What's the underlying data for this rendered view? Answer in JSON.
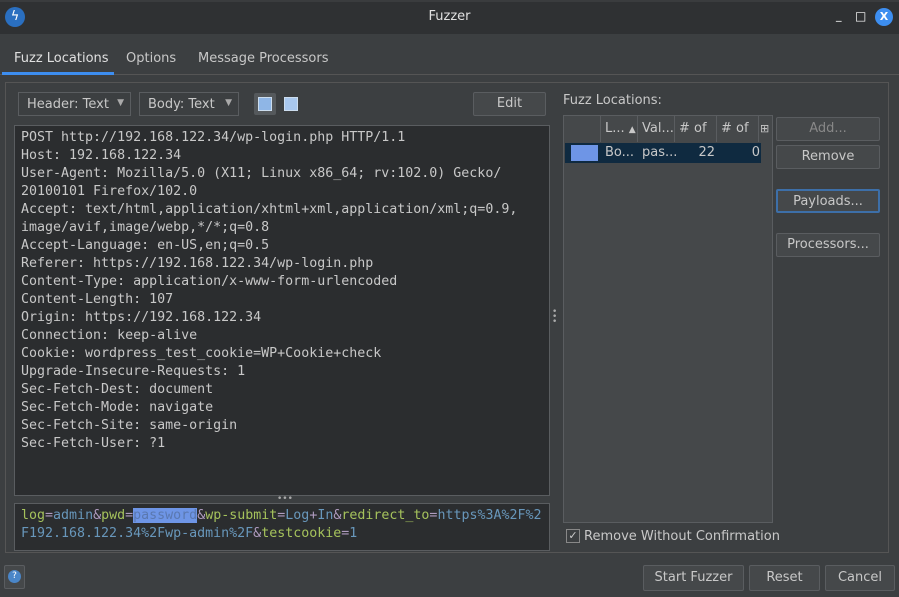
{
  "window": {
    "title": "Fuzzer",
    "minimize": "_",
    "maximize": "□",
    "close": "X"
  },
  "tabs": [
    {
      "label": "Fuzz Locations",
      "selected": true
    },
    {
      "label": "Options"
    },
    {
      "label": "Message Processors"
    }
  ],
  "toolbar": {
    "header_view": "Header: Text",
    "body_view": "Body: Text",
    "edit_label": "Edit"
  },
  "request_header": [
    "POST http://192.168.122.34/wp-login.php HTTP/1.1",
    "Host: 192.168.122.34",
    "User-Agent: Mozilla/5.0 (X11; Linux x86_64; rv:102.0) Gecko/",
    "20100101 Firefox/102.0",
    "Accept: text/html,application/xhtml+xml,application/xml;q=0.9,",
    "image/avif,image/webp,*/*;q=0.8",
    "Accept-Language: en-US,en;q=0.5",
    "Referer: https://192.168.122.34/wp-login.php",
    "Content-Type: application/x-www-form-urlencoded",
    "Content-Length: 107",
    "Origin: https://192.168.122.34",
    "Connection: keep-alive",
    "Cookie: wordpress_test_cookie=WP+Cookie+check",
    "Upgrade-Insecure-Requests: 1",
    "Sec-Fetch-Dest: document",
    "Sec-Fetch-Mode: navigate",
    "Sec-Fetch-Site: same-origin",
    "Sec-Fetch-User: ?1"
  ],
  "request_body": [
    [
      "k",
      "log"
    ],
    [
      "s",
      "="
    ],
    [
      "v",
      "admin"
    ],
    [
      "s",
      "&"
    ],
    [
      "k",
      "pwd"
    ],
    [
      "s",
      "="
    ],
    [
      "hl",
      "password"
    ],
    [
      "s",
      "&"
    ],
    [
      "k",
      "wp-submit"
    ],
    [
      "s",
      "="
    ],
    [
      "v",
      "Log"
    ],
    [
      "s",
      "+"
    ],
    [
      "v",
      "In"
    ],
    [
      "s",
      "&"
    ],
    [
      "k",
      "redirect_to"
    ],
    [
      "s",
      "="
    ],
    [
      "v",
      "https%3A%2F%2F192.168.122.34%2Fwp-admin%2F"
    ],
    [
      "s",
      "&"
    ],
    [
      "k",
      "testcookie"
    ],
    [
      "s",
      "="
    ],
    [
      "v",
      "1"
    ]
  ],
  "fuzz_locations": {
    "label": "Fuzz Locations:",
    "columns": [
      "L...",
      "Val...",
      "# of ...",
      "# of ..."
    ],
    "sort_indicator": "▲",
    "rows": [
      {
        "color": "#6e95e6",
        "location": "Bo...",
        "value": "pas...",
        "payloads": "22",
        "processors": "0"
      }
    ]
  },
  "side_buttons": {
    "add": "Add...",
    "remove": "Remove",
    "payloads": "Payloads...",
    "processors": "Processors..."
  },
  "remove_without_confirmation": {
    "label": "Remove Without Confirmation",
    "checked": true
  },
  "footer": {
    "start": "Start Fuzzer",
    "reset": "Reset",
    "cancel": "Cancel"
  }
}
